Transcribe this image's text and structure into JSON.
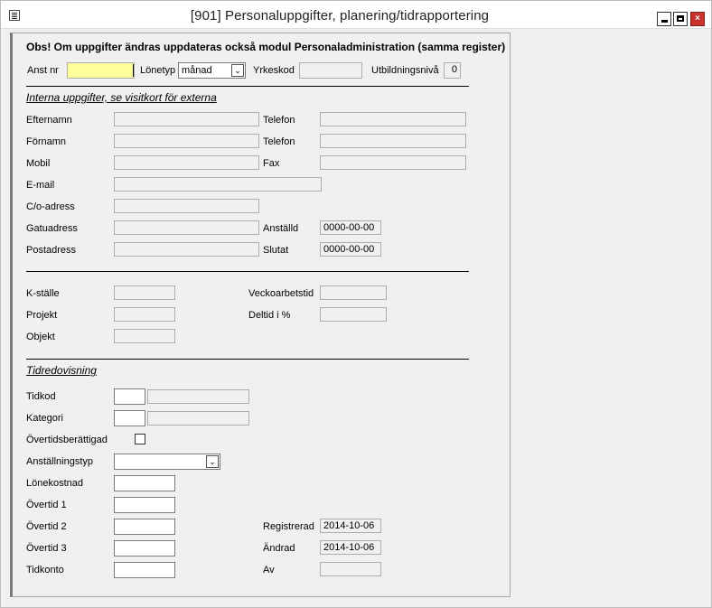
{
  "window": {
    "title": "[901]  Personaluppgifter, planering/tidrapportering",
    "icon": "form-icon",
    "controls": {
      "minimize": "minimize-icon",
      "maximize": "maximize-icon",
      "close": "close-icon",
      "close_symbol": "×"
    }
  },
  "notice": "Obs! Om uppgifter ändras uppdateras också modul Personaladministration (samma register)",
  "top_row": {
    "anst_nr_label": "Anst nr",
    "anst_nr_value": "",
    "lonetyp_label": "Lönetyp",
    "lonetyp_value": "månad",
    "yrkeskod_label": "Yrkeskod",
    "yrkeskod_value": "",
    "utbildningsniva_label": "Utbildningsnivå",
    "utbildningsniva_value": "0"
  },
  "internal": {
    "heading": "Interna uppgifter, se visitkort för externa",
    "efternamn": "Efternamn",
    "fornamn": "Förnamn",
    "mobil": "Mobil",
    "email": "E-mail",
    "co_adress": "C/o-adress",
    "gatuadress": "Gatuadress",
    "postadress": "Postadress",
    "telefon1": "Telefon",
    "telefon2": "Telefon",
    "fax": "Fax",
    "anstalld_label": "Anställd",
    "anstalld_value": "0000-00-00",
    "slutat_label": "Slutat",
    "slutat_value": "0000-00-00"
  },
  "org": {
    "k_stalle": "K-ställe",
    "projekt": "Projekt",
    "objekt": "Objekt",
    "veckoarbetstid": "Veckoarbetstid",
    "deltid": "Deltid i %"
  },
  "time": {
    "heading": "Tidredovisning",
    "tidkod": "Tidkod",
    "kategori": "Kategori",
    "overtidsberattigad": "Övertidsberättigad",
    "anstallningstyp": "Anställningstyp",
    "anstallningstyp_value": "",
    "lonekostnad": "Lönekostnad",
    "overtid1": "Övertid 1",
    "overtid2": "Övertid 2",
    "overtid3": "Övertid 3",
    "tidkonto": "Tidkonto",
    "registrerad_label": "Registrerad",
    "registrerad_value": "2014-10-06",
    "andrad_label": "Ändrad",
    "andrad_value": "2014-10-06",
    "av_label": "Av",
    "av_value": ""
  }
}
